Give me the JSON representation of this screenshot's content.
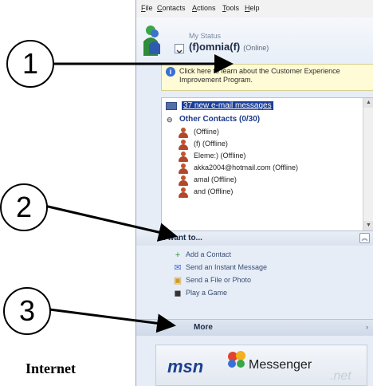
{
  "menu": [
    "File",
    "Contacts",
    "Actions",
    "Tools",
    "Help"
  ],
  "status": {
    "caption": "My Status",
    "name": "(f)omnia(f)",
    "state": "(Online)"
  },
  "info_bar": {
    "icon": "info-icon",
    "text": "Click here to learn about the Customer Experience Improvement Program."
  },
  "mail_link": "37 new e-mail messages",
  "group": {
    "title": "Other Contacts (0/30)"
  },
  "contacts": [
    "(Offline)",
    "(f) (Offline)",
    "Eleme:) (Offline)",
    "akka2004@hotmail.com (Offline)",
    "amal (Offline)",
    "and (Offline)"
  ],
  "want": {
    "title": "I want to...",
    "actions": [
      {
        "label": "Add a Contact",
        "icon": "add-contact-icon"
      },
      {
        "label": "Send an Instant Message",
        "icon": "instant-message-icon"
      },
      {
        "label": "Send a File or Photo",
        "icon": "file-photo-icon"
      },
      {
        "label": "Play a Game",
        "icon": "game-icon"
      }
    ]
  },
  "more": "More",
  "banner": {
    "msn": "msn",
    "messenger": "Messenger",
    "net": ".net"
  },
  "callouts": [
    "1",
    "2",
    "3"
  ],
  "caption": "Internet",
  "colors": {
    "window_bg": "#e6edf7",
    "link_highlight": "#1c3f9a",
    "group_header": "#1d3a8a",
    "contact_icon": "#c0542b",
    "info_bg": "#fffbd6"
  }
}
